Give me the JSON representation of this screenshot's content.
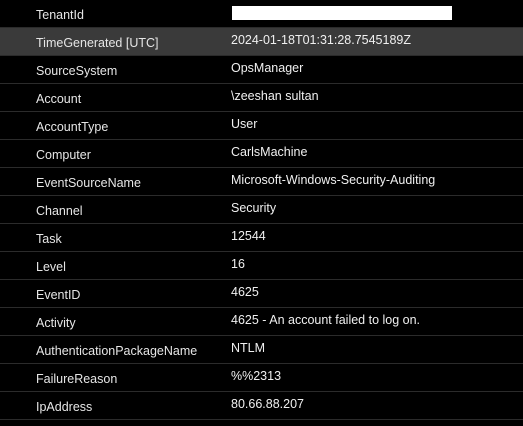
{
  "rows": [
    {
      "key": "TenantId",
      "value": "",
      "redacted": true
    },
    {
      "key": "TimeGenerated [UTC]",
      "value": "2024-01-18T01:31:28.7545189Z",
      "selected": true
    },
    {
      "key": "SourceSystem",
      "value": "OpsManager"
    },
    {
      "key": "Account",
      "value": "\\zeeshan sultan"
    },
    {
      "key": "AccountType",
      "value": "User"
    },
    {
      "key": "Computer",
      "value": "CarlsMachine"
    },
    {
      "key": "EventSourceName",
      "value": "Microsoft-Windows-Security-Auditing"
    },
    {
      "key": "Channel",
      "value": "Security"
    },
    {
      "key": "Task",
      "value": "12544"
    },
    {
      "key": "Level",
      "value": "16"
    },
    {
      "key": "EventID",
      "value": "4625"
    },
    {
      "key": "Activity",
      "value": "4625 - An account failed to log on."
    },
    {
      "key": "AuthenticationPackageName",
      "value": "NTLM"
    },
    {
      "key": "FailureReason",
      "value": "%%2313"
    },
    {
      "key": "IpAddress",
      "value": "80.66.88.207"
    }
  ]
}
